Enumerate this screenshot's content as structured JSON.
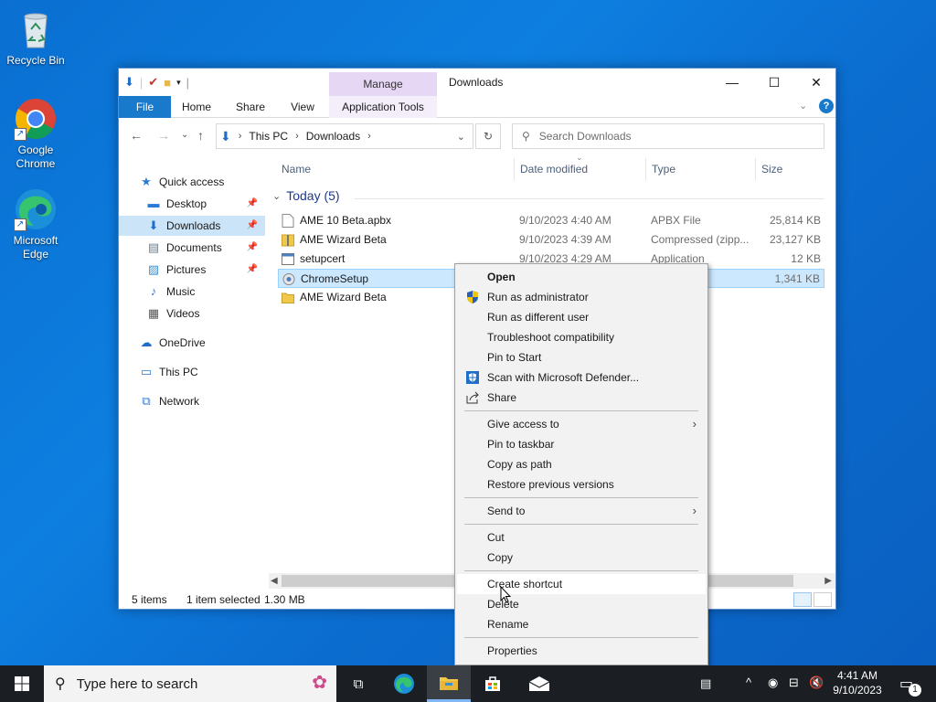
{
  "desktop": {
    "icons": [
      {
        "label": "Recycle Bin"
      },
      {
        "label": "Google Chrome"
      },
      {
        "label": "Microsoft Edge"
      }
    ]
  },
  "window": {
    "title": "Downloads",
    "manage_tab": "Manage",
    "ribbon_tabs": [
      "File",
      "Home",
      "Share",
      "View",
      "Application Tools"
    ],
    "controls": {
      "minimize": "—",
      "maximize": "☐",
      "close": "✕"
    }
  },
  "address": {
    "segments": [
      "This PC",
      "Downloads"
    ],
    "search_placeholder": "Search Downloads"
  },
  "nav": {
    "items": [
      {
        "label": "Quick access",
        "icon": "star-icon"
      },
      {
        "label": "Desktop",
        "icon": "desktop-icon",
        "pinned": true
      },
      {
        "label": "Downloads",
        "icon": "download-arrow-icon",
        "pinned": true,
        "selected": true
      },
      {
        "label": "Documents",
        "icon": "documents-icon",
        "pinned": true
      },
      {
        "label": "Pictures",
        "icon": "pictures-icon",
        "pinned": true
      },
      {
        "label": "Music",
        "icon": "music-icon"
      },
      {
        "label": "Videos",
        "icon": "videos-icon"
      },
      {
        "label": "OneDrive",
        "icon": "cloud-icon"
      },
      {
        "label": "This PC",
        "icon": "computer-icon"
      },
      {
        "label": "Network",
        "icon": "network-icon"
      }
    ]
  },
  "columns": {
    "name": "Name",
    "date": "Date modified",
    "type": "Type",
    "size": "Size"
  },
  "group": {
    "label": "Today (5)"
  },
  "files": [
    {
      "name": "AME 10 Beta.apbx",
      "date": "9/10/2023 4:40 AM",
      "type": "APBX File",
      "size": "25,814 KB",
      "icon": "file-icon"
    },
    {
      "name": "AME Wizard Beta",
      "date": "9/10/2023 4:39 AM",
      "type": "Compressed (zipp...",
      "size": "23,127 KB",
      "icon": "zip-folder-icon"
    },
    {
      "name": "setupcert",
      "date": "9/10/2023 4:29 AM",
      "type": "Application",
      "size": "12 KB",
      "icon": "app-icon"
    },
    {
      "name": "ChromeSetup",
      "date": "",
      "type": "",
      "size": "1,341 KB",
      "icon": "installer-icon",
      "selected": true
    },
    {
      "name": "AME Wizard Beta",
      "date": "",
      "type": "",
      "size": "",
      "icon": "folder-icon"
    }
  ],
  "status": {
    "count": "5 items",
    "selected": "1 item selected",
    "size": "1.30 MB"
  },
  "context_menu": {
    "groups": [
      [
        {
          "label": "Open",
          "bold": true
        },
        {
          "label": "Run as administrator",
          "icon": "uac-shield-icon"
        },
        {
          "label": "Run as different user"
        },
        {
          "label": "Troubleshoot compatibility"
        },
        {
          "label": "Pin to Start"
        },
        {
          "label": "Scan with Microsoft Defender...",
          "icon": "defender-icon"
        },
        {
          "label": "Share",
          "icon": "share-icon"
        }
      ],
      [
        {
          "label": "Give access to",
          "submenu": true
        },
        {
          "label": "Pin to taskbar"
        },
        {
          "label": "Copy as path"
        },
        {
          "label": "Restore previous versions"
        }
      ],
      [
        {
          "label": "Send to",
          "submenu": true
        }
      ],
      [
        {
          "label": "Cut"
        },
        {
          "label": "Copy"
        }
      ],
      [
        {
          "label": "Create shortcut",
          "hover": true
        },
        {
          "label": "Delete"
        },
        {
          "label": "Rename"
        }
      ],
      [
        {
          "label": "Properties"
        }
      ]
    ]
  },
  "taskbar": {
    "search_placeholder": "Type here to search",
    "time": "4:41 AM",
    "date": "9/10/2023",
    "notification_count": "1"
  },
  "colors": {
    "accent": "#1979ca",
    "selection": "#cce8ff",
    "manage_tab": "#e6d7f5"
  }
}
